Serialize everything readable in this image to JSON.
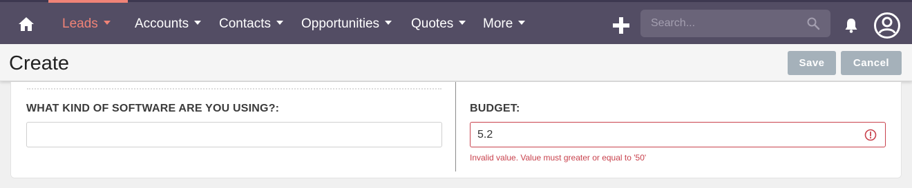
{
  "nav": {
    "items": [
      {
        "label": "Leads",
        "active": true
      },
      {
        "label": "Accounts",
        "active": false
      },
      {
        "label": "Contacts",
        "active": false
      },
      {
        "label": "Opportunities",
        "active": false
      },
      {
        "label": "Quotes",
        "active": false
      },
      {
        "label": "More",
        "active": false
      }
    ],
    "search_placeholder": "Search...",
    "icons": [
      "home-icon",
      "plus-icon",
      "search-icon",
      "bell-icon",
      "user-icon"
    ],
    "colors": {
      "bar": "#534d64",
      "active": "#f08377"
    }
  },
  "header": {
    "title": "Create",
    "save_label": "Save",
    "cancel_label": "Cancel"
  },
  "form": {
    "software": {
      "label": "WHAT KIND OF SOFTWARE ARE YOU USING?:",
      "value": ""
    },
    "budget": {
      "label": "BUDGET:",
      "value": "5.2",
      "error": "Invalid value. Value must greater or equal to '50'",
      "error_color": "#c8414c"
    }
  }
}
